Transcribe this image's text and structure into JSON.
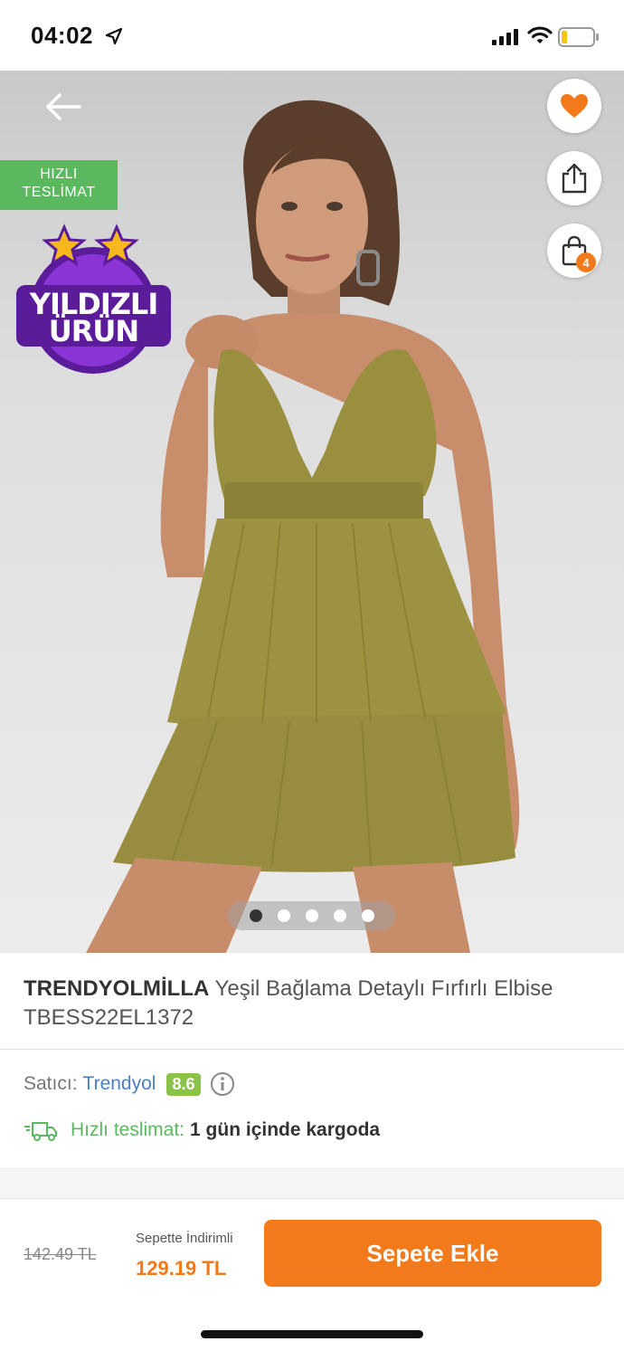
{
  "status_bar": {
    "time": "04:02"
  },
  "hero": {
    "fast_badge_line1": "HIZLI",
    "fast_badge_line2": "TESLİMAT",
    "star_badge_line1": "YILDIZLI",
    "star_badge_line2": "ÜRÜN",
    "cart_count": "4",
    "image_count": 5,
    "active_image": 1
  },
  "product": {
    "brand": "TRENDYOLMİLLA",
    "name": "Yeşil Bağlama Detaylı Fırfırlı Elbise TBESS22EL1372"
  },
  "seller": {
    "label": "Satıcı:",
    "name": "Trendyol",
    "rating": "8.6"
  },
  "delivery": {
    "label": "Hızlı teslimat:",
    "value": "1 gün içinde kargoda"
  },
  "bottom_bar": {
    "old_price": "142.49 TL",
    "basket_label": "Sepette İndirimli",
    "new_price": "129.19 TL",
    "add_button": "Sepete Ekle"
  },
  "colors": {
    "accent": "#f27a1a",
    "green": "#5ab95f",
    "link": "#4a7fc9",
    "rating": "#8bc34a",
    "dress": "#9a8f3f"
  }
}
